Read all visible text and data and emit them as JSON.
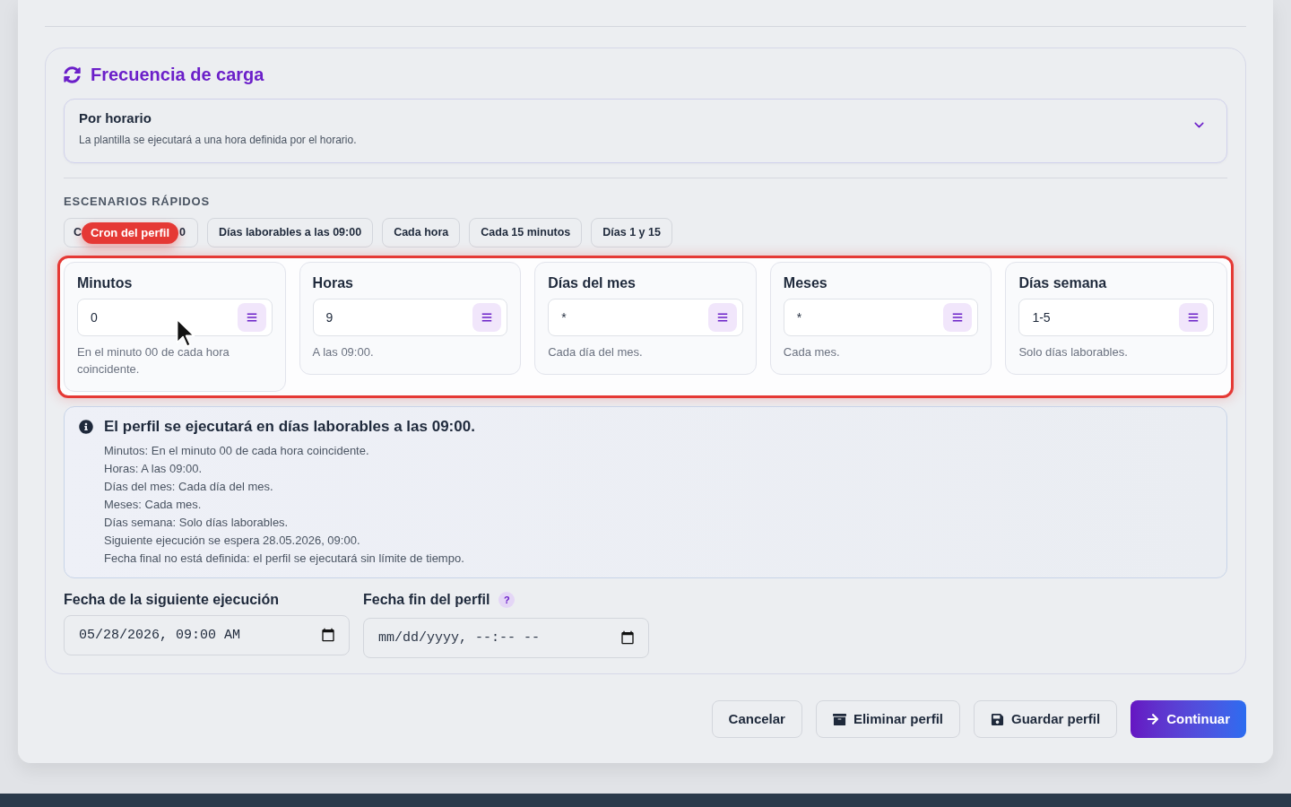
{
  "section": {
    "title": "Frecuencia de carga",
    "frequency_select": {
      "value": "Por horario",
      "description": "La plantilla se ejecutará a una hora definida por el horario."
    },
    "quick_scenarios": {
      "heading": "ESCENARIOS RÁPIDOS",
      "chips": [
        {
          "kind": "covered",
          "visible_start": "C",
          "visible_end": "0",
          "tooltip": "Cron del perfil"
        },
        {
          "kind": "plain",
          "label": "Días laborables a las 09:00"
        },
        {
          "kind": "plain",
          "label": "Cada hora"
        },
        {
          "kind": "plain",
          "label": "Cada 15 minutos"
        },
        {
          "kind": "plain",
          "label": "Días 1 y 15"
        }
      ]
    },
    "cron_fields": {
      "highlighted": true,
      "items": [
        {
          "label": "Minutos",
          "value": "0",
          "description": "En el minuto 00 de cada hora coincidente."
        },
        {
          "label": "Horas",
          "value": "9",
          "description": "A las 09:00."
        },
        {
          "label": "Días del mes",
          "value": "*",
          "description": "Cada día del mes."
        },
        {
          "label": "Meses",
          "value": "*",
          "description": "Cada mes."
        },
        {
          "label": "Días semana",
          "value": "1-5",
          "description": "Solo días laborables."
        }
      ]
    },
    "summary": {
      "title": "El perfil se ejecutará en días laborables a las 09:00.",
      "lines": [
        "Minutos: En el minuto 00 de cada hora coincidente.",
        "Horas: A las 09:00.",
        "Días del mes: Cada día del mes.",
        "Meses: Cada mes.",
        "Días semana: Solo días laborables.",
        "Siguiente ejecución se espera 28.05.2026, 09:00.",
        "Fecha final no está definida: el perfil se ejecutará sin límite de tiempo."
      ]
    },
    "date_fields": [
      {
        "label": "Fecha de la siguiente ejecución",
        "value": "05/28/2026, 09:00 AM"
      },
      {
        "label": "Fecha fin del perfil",
        "help": "?",
        "placeholder": "mm/dd/yyyy, --:-- --"
      }
    ]
  },
  "actions": [
    {
      "kind": "plain",
      "label": "Cancelar"
    },
    {
      "kind": "archive",
      "label": "Eliminar perfil"
    },
    {
      "kind": "save",
      "label": "Guardar perfil"
    },
    {
      "kind": "primary",
      "label": "Continuar"
    }
  ]
}
